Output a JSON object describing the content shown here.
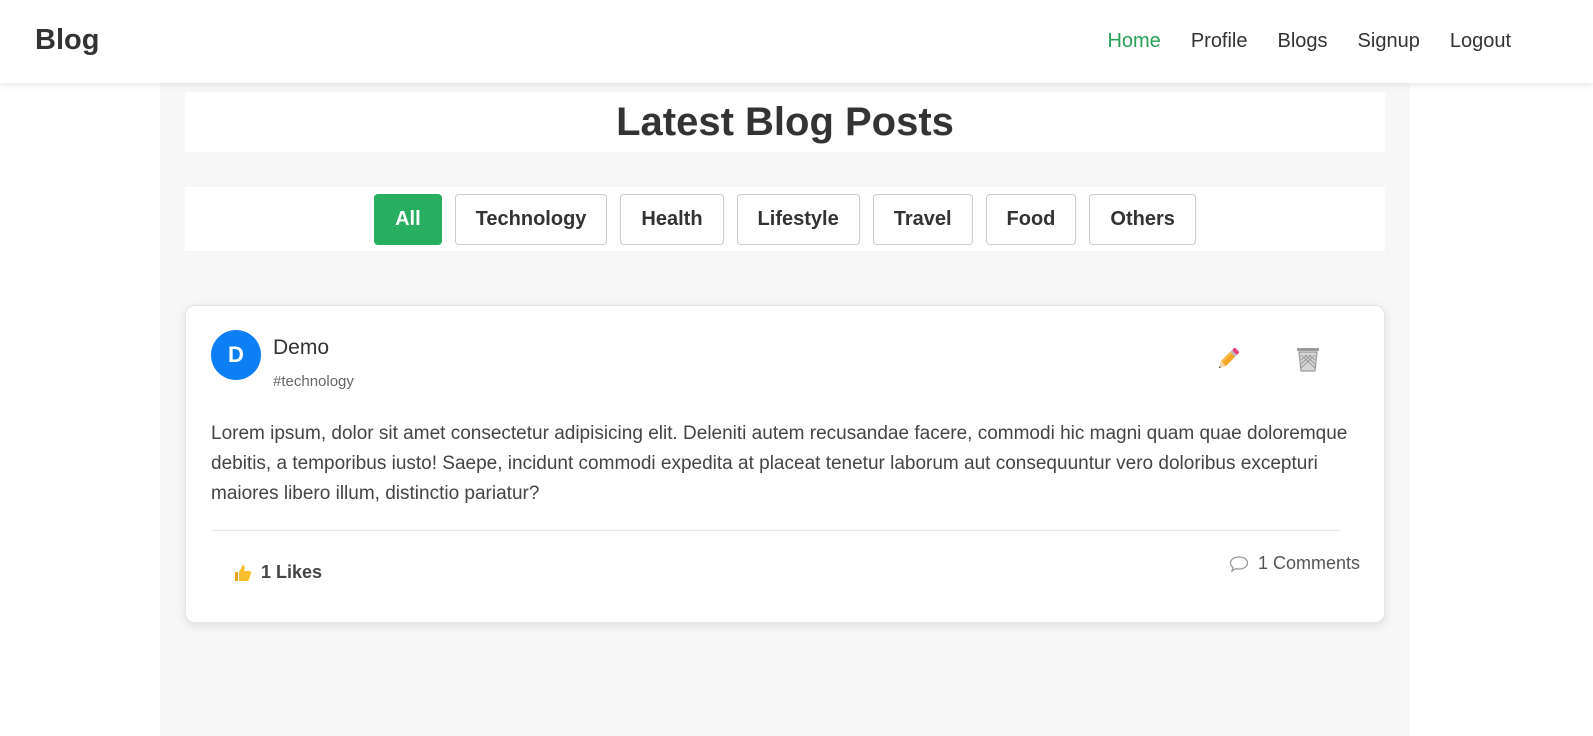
{
  "nav": {
    "brand": "Blog",
    "links": [
      "Home",
      "Profile",
      "Blogs",
      "Signup",
      "Logout"
    ],
    "active": "Home"
  },
  "page": {
    "title": "Latest Blog Posts"
  },
  "filters": {
    "options": [
      "All",
      "Technology",
      "Health",
      "Lifestyle",
      "Travel",
      "Food",
      "Others"
    ],
    "active": "All"
  },
  "post": {
    "avatar_letter": "D",
    "author": "Demo",
    "tag": "#technology",
    "body": "Lorem ipsum, dolor sit amet consectetur adipisicing elit. Deleniti autem recusandae facere, commodi hic magni quam quae doloremque debitis, a temporibus iusto! Saepe, incidunt commodi expedita at placeat tenetur laborum aut consequuntur vero doloribus excepturi maiores libero illum, distinctio pariatur?",
    "likes_label": "1 Likes",
    "comments_label": "1 Comments",
    "icons": {
      "edit": "pencil-icon",
      "delete": "trash-icon",
      "like": "thumbs-up-icon",
      "comment": "speech-bubble-icon"
    }
  },
  "colors": {
    "accent": "#27ae60",
    "nav_active": "#28a05a",
    "avatar": "#0d7ff5"
  }
}
